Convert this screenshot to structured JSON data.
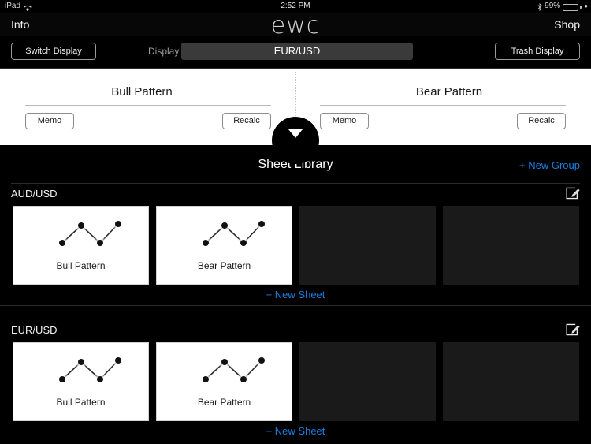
{
  "statusbar": {
    "device": "iPad",
    "wifi_icon": "wifi-icon",
    "time": "2:52 PM",
    "bluetooth_icon": "bluetooth-icon",
    "battery_percent": "99%",
    "battery_icon": "battery-icon"
  },
  "navbar": {
    "info_label": "Info",
    "logo": "ewc",
    "shop_label": "Shop"
  },
  "toolbar": {
    "switch_display_label": "Switch Display",
    "display_label": "Display",
    "display_value": "EUR/USD",
    "trash_display_label": "Trash Display"
  },
  "patterns": {
    "left": {
      "title": "Bull Pattern",
      "memo_label": "Memo",
      "recalc_label": "Recalc"
    },
    "right": {
      "title": "Bear Pattern",
      "memo_label": "Memo",
      "recalc_label": "Recalc"
    },
    "pull_tab_icon": "chevron-down-icon"
  },
  "library": {
    "title": "Sheet Library",
    "new_group_label": "+ New Group",
    "new_sheet_label": "+ New Sheet",
    "edit_icon": "compose-icon",
    "groups": [
      {
        "name": "AUD/USD",
        "sheets": [
          {
            "label": "Bull Pattern",
            "empty": false
          },
          {
            "label": "Bear Pattern",
            "empty": false
          },
          {
            "label": "",
            "empty": true
          },
          {
            "label": "",
            "empty": true
          }
        ]
      },
      {
        "name": "EUR/USD",
        "sheets": [
          {
            "label": "Bull Pattern",
            "empty": false
          },
          {
            "label": "Bear Pattern",
            "empty": false
          },
          {
            "label": "",
            "empty": true
          },
          {
            "label": "",
            "empty": true
          }
        ]
      }
    ]
  },
  "colors": {
    "background": "#000000",
    "accent_blue": "#1a7fe0",
    "card_white": "#ffffff",
    "empty_slot": "#1a1a1a",
    "battery_green": "#4cd964"
  }
}
